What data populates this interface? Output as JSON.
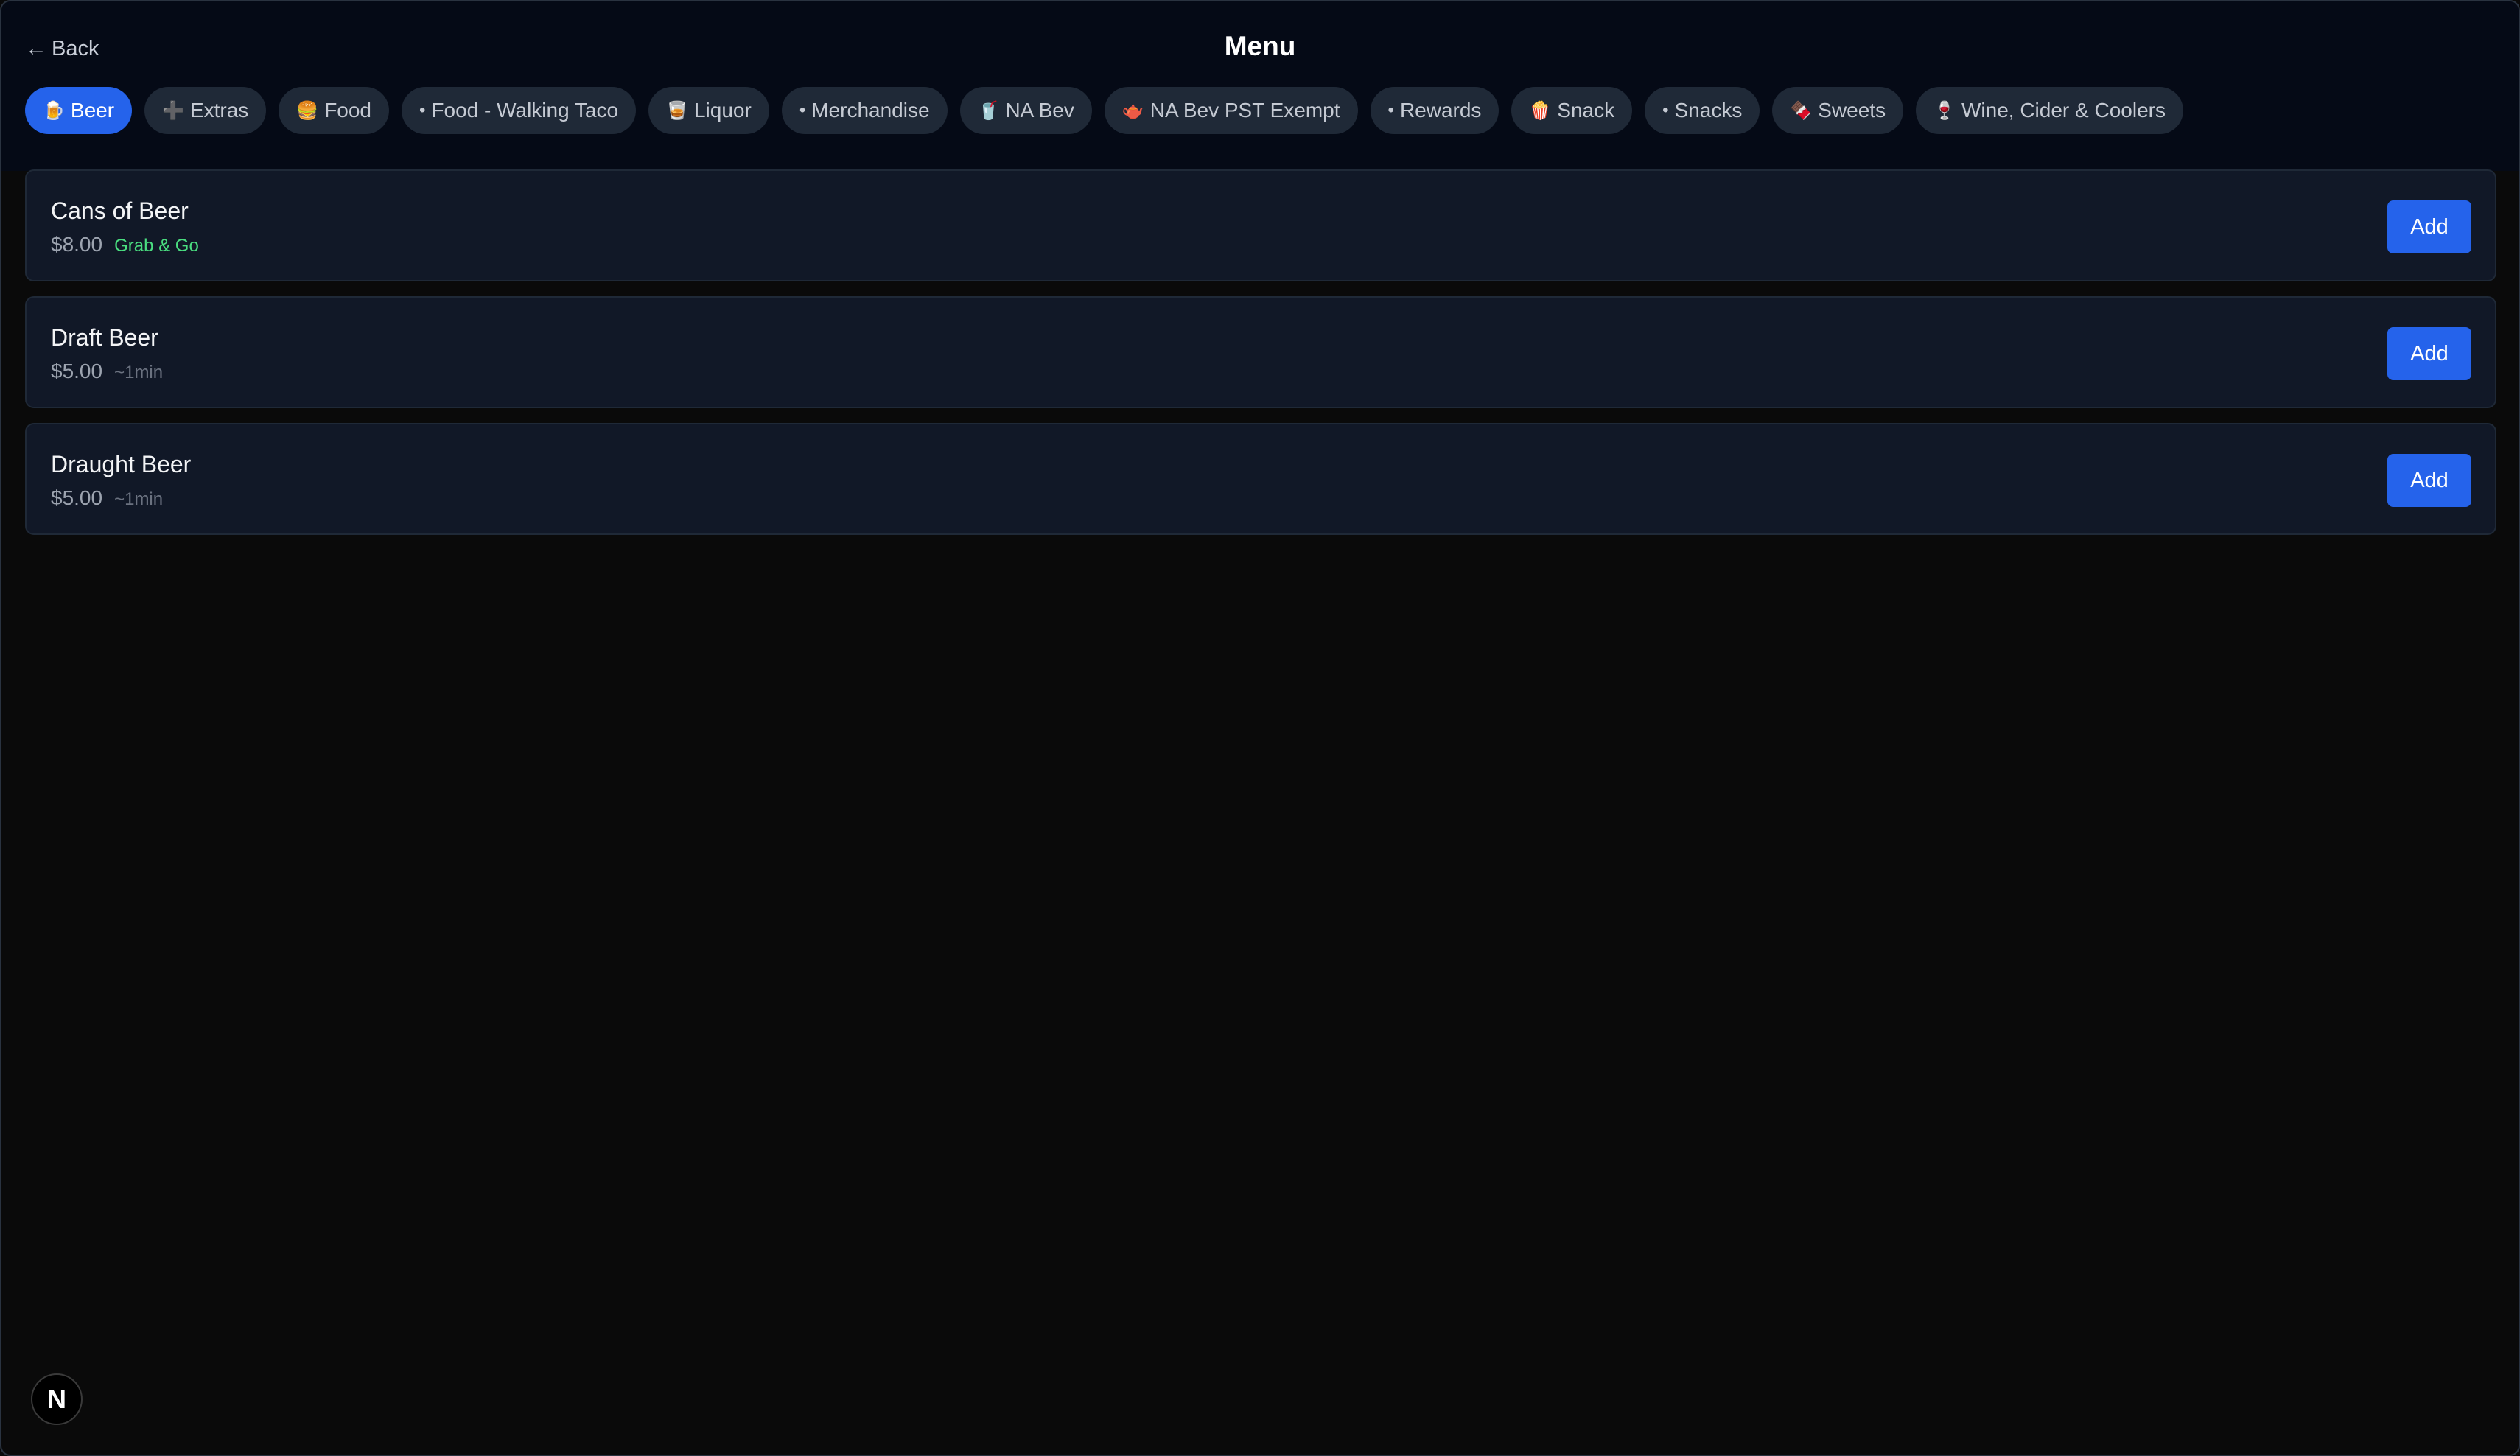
{
  "header": {
    "back_label": "Back",
    "back_icon": "arrow-left-icon",
    "title": "Menu"
  },
  "tabs": [
    {
      "label": "Beer",
      "icon": "🍺",
      "active": true
    },
    {
      "label": "Extras",
      "icon": "➕",
      "active": false
    },
    {
      "label": "Food",
      "icon": "🍔",
      "active": false
    },
    {
      "label": "Food - Walking Taco",
      "icon": "•",
      "active": false
    },
    {
      "label": "Liquor",
      "icon": "🥃",
      "active": false
    },
    {
      "label": "Merchandise",
      "icon": "•",
      "active": false
    },
    {
      "label": "NA Bev",
      "icon": "🥤",
      "active": false
    },
    {
      "label": "NA Bev PST Exempt",
      "icon": "🫖",
      "active": false
    },
    {
      "label": "Rewards",
      "icon": "•",
      "active": false
    },
    {
      "label": "Snack",
      "icon": "🍿",
      "active": false
    },
    {
      "label": "Snacks",
      "icon": "•",
      "active": false
    },
    {
      "label": "Sweets",
      "icon": "🍫",
      "active": false
    },
    {
      "label": "Wine, Cider & Coolers",
      "icon": "🍷",
      "active": false
    }
  ],
  "items": [
    {
      "name": "Cans of Beer",
      "price": "$8.00",
      "tag": "Grab & Go",
      "eta": "",
      "add_label": "Add"
    },
    {
      "name": "Draft Beer",
      "price": "$5.00",
      "tag": "",
      "eta": "~1min",
      "add_label": "Add"
    },
    {
      "name": "Draught Beer",
      "price": "$5.00",
      "tag": "",
      "eta": "~1min",
      "add_label": "Add"
    }
  ],
  "dev_badge": "N",
  "colors": {
    "accent": "#2563eb",
    "background": "#0a0a0a",
    "card": "#111827",
    "tag_green": "#4ade80"
  }
}
